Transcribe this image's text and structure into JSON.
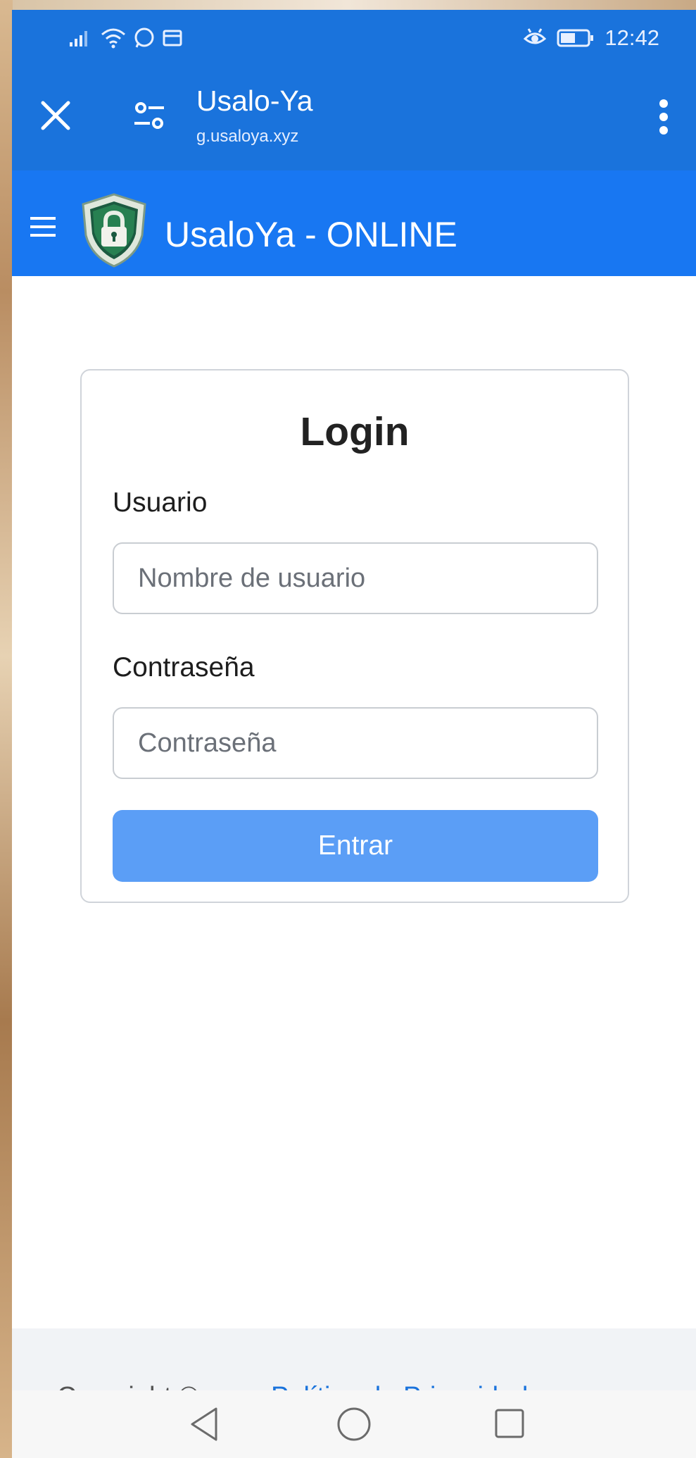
{
  "status_bar": {
    "time": "12:42"
  },
  "browser": {
    "title": "Usalo-Ya",
    "url": "g.usaloya.xyz"
  },
  "app_header": {
    "title": "UsaloYa - ONLINE"
  },
  "login": {
    "title": "Login",
    "user_label": "Usuario",
    "user_placeholder": "Nombre de usuario",
    "password_label": "Contraseña",
    "password_placeholder": "Contraseña",
    "submit_label": "Entrar"
  },
  "footer": {
    "copyright": "Copyright ©",
    "privacy": "Política de Privacidad ·"
  },
  "colors": {
    "browser_bar": "#1a73dc",
    "app_header": "#1877f2",
    "button": "#5b9ef6"
  },
  "icons": {
    "close": "close-icon",
    "tune": "tune-icon",
    "more": "more-vert-icon",
    "menu": "hamburger-icon",
    "logo": "shield-lock-icon",
    "back": "back-icon",
    "home": "home-icon",
    "recent": "recent-apps-icon"
  }
}
